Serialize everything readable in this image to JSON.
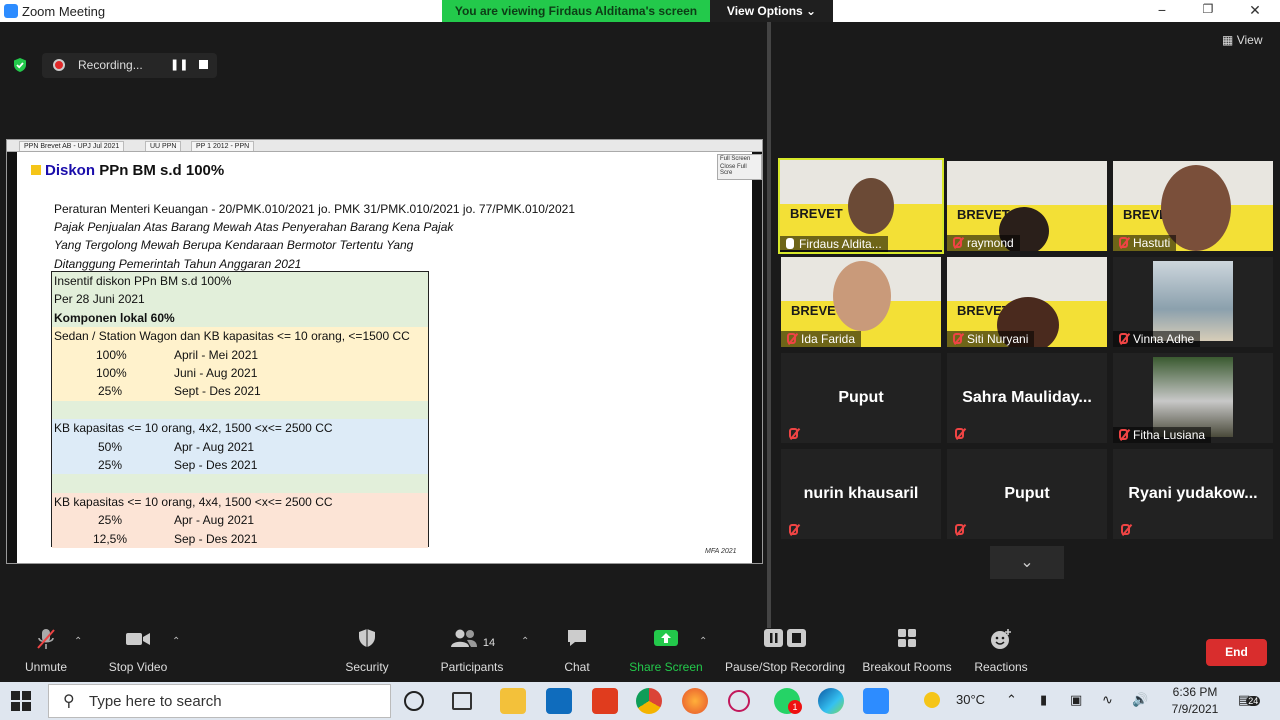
{
  "window": {
    "title": "Zoom Meeting",
    "minimize": "−",
    "maximize": "❐",
    "close": "✕"
  },
  "banner": {
    "viewing": "You are viewing Firdaus Alditama's screen",
    "view_options": "View Options ⌄"
  },
  "recording": {
    "label": "Recording...",
    "pause": "❚❚"
  },
  "ppt_tabs": [
    "PPN Brevet AB - UPJ Jul 2021",
    "UU PPN",
    "PP 1 2012 - PPN"
  ],
  "ppt_menu": [
    "Full Screen",
    "Close Full Scre"
  ],
  "slide": {
    "title_keyword": "Diskon",
    "title_rest": "PPn BM s.d 100%",
    "reg_line1": "Peraturan Menteri Keuangan - 20/PMK.010/2021 jo. PMK 31/PMK.010/2021 jo. 77/PMK.010/2021",
    "reg_line2": "Pajak Penjualan Atas Barang Mewah Atas Penyerahan Barang Kena Pajak",
    "reg_line3": "Yang Tergolong Mewah Berupa Kendaraan Bermotor Tertentu Yang",
    "reg_line4": "Ditanggung Pemerintah Tahun Anggaran 2021",
    "table": {
      "head1": "Insentif diskon PPn BM s.d 100%",
      "head2": "Per 28 Juni 2021",
      "head3": "Komponen lokal 60%",
      "g1_title": "Sedan / Station Wagon dan KB kapasitas <= 10 orang, <=1500 CC",
      "g1_rows": [
        {
          "pct": "100%",
          "period": "April - Mei 2021"
        },
        {
          "pct": "100%",
          "period": "Juni - Aug 2021"
        },
        {
          "pct": "25%",
          "period": "Sept - Des 2021"
        }
      ],
      "g2_title": "KB kapasitas <= 10 orang, 4x2, 1500 <x<= 2500 CC",
      "g2_rows": [
        {
          "pct": "50%",
          "period": "Apr - Aug 2021"
        },
        {
          "pct": "25%",
          "period": "Sep - Des 2021"
        }
      ],
      "g3_title": "KB kapasitas <= 10 orang, 4x4, 1500 <x<= 2500 CC",
      "g3_rows": [
        {
          "pct": "25%",
          "period": "Apr - Aug 2021"
        },
        {
          "pct": "12,5%",
          "period": "Sep - Des 2021"
        }
      ]
    },
    "footer": "MFA 2021"
  },
  "gallery": {
    "view_label": "View",
    "video_brand": "BREVET",
    "participants": [
      {
        "name": "Firdaus Aldita...",
        "type": "video",
        "active": true
      },
      {
        "name": "raymond",
        "type": "video"
      },
      {
        "name": "Hastuti",
        "type": "video"
      },
      {
        "name": "Ida Farida",
        "type": "video"
      },
      {
        "name": "Siti Nuryani",
        "type": "video"
      },
      {
        "name": "Vinna Adhe",
        "type": "photo"
      },
      {
        "name": "Puput",
        "type": "name"
      },
      {
        "name": "Sahra  Mauliday...",
        "type": "name"
      },
      {
        "name": "Fitha Lusiana",
        "type": "photo"
      },
      {
        "name": "nurin khausaril",
        "type": "name"
      },
      {
        "name": "Puput",
        "type": "name"
      },
      {
        "name": "Ryani  yudakow...",
        "type": "name"
      }
    ]
  },
  "toolbar": {
    "unmute": "Unmute",
    "stop_video": "Stop Video",
    "security": "Security",
    "participants": "Participants",
    "participants_count": "14",
    "chat": "Chat",
    "share_screen": "Share Screen",
    "pause_stop_recording": "Pause/Stop Recording",
    "breakout_rooms": "Breakout Rooms",
    "reactions": "Reactions",
    "end": "End"
  },
  "taskbar": {
    "search_placeholder": "Type here to search",
    "temperature": "30°C",
    "time": "6:36 PM",
    "date": "7/9/2021",
    "notifications": "24",
    "whatsapp_badge": "1"
  },
  "colors": {
    "banner_green": "#23c94b",
    "end_red": "#d92d2d",
    "active_speaker": "#d7e82a",
    "zoom_blue": "#2d8cff"
  }
}
